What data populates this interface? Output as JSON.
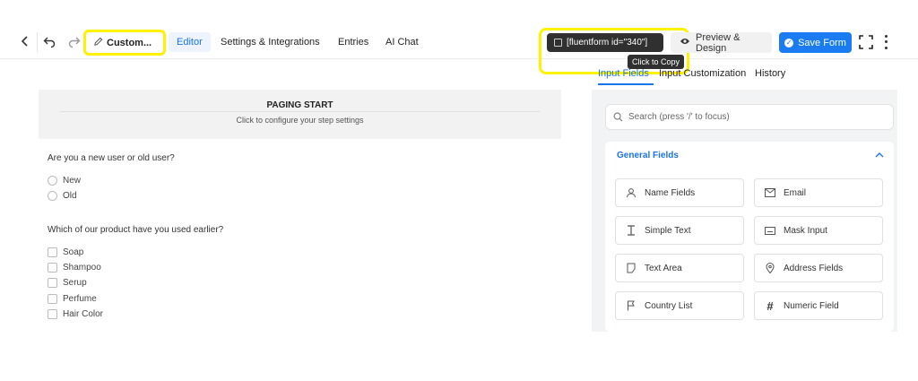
{
  "topbar": {
    "form_title": "Custom...",
    "tabs": [
      "Editor",
      "Settings & Integrations",
      "Entries",
      "AI Chat"
    ],
    "shortcode": "[fluentform id=\"340\"]",
    "shortcode_tooltip": "Click to Copy",
    "preview_label": "Preview & Design",
    "save_label": "Save Form"
  },
  "canvas": {
    "paging_title": "PAGING START",
    "paging_subtitle": "Click to configure your step settings",
    "question1": "Are you a new user or old user?",
    "question1_options": [
      "New",
      "Old"
    ],
    "question2": "Which of our product have you used earlier?",
    "question2_options": [
      "Soap",
      "Shampoo",
      "Serup",
      "Perfume",
      "Hair Color"
    ]
  },
  "sidebar": {
    "tabs": [
      "Input Fields",
      "Input Customization",
      "History"
    ],
    "search_placeholder": "Search (press '/' to focus)",
    "section_title": "General Fields",
    "fields": [
      {
        "label": "Name Fields",
        "icon": "user-icon"
      },
      {
        "label": "Email",
        "icon": "email-icon"
      },
      {
        "label": "Simple Text",
        "icon": "text-cursor-icon"
      },
      {
        "label": "Mask Input",
        "icon": "keyboard-icon"
      },
      {
        "label": "Text Area",
        "icon": "paragraph-icon"
      },
      {
        "label": "Address Fields",
        "icon": "map-pin-icon"
      },
      {
        "label": "Country List",
        "icon": "flag-icon"
      },
      {
        "label": "Numeric Field",
        "icon": "hash-icon"
      }
    ]
  },
  "colors": {
    "accent": "#1a73e8",
    "save_button": "#1a7cf0",
    "highlight": "#fff200",
    "shortcode_bg": "#303030"
  }
}
